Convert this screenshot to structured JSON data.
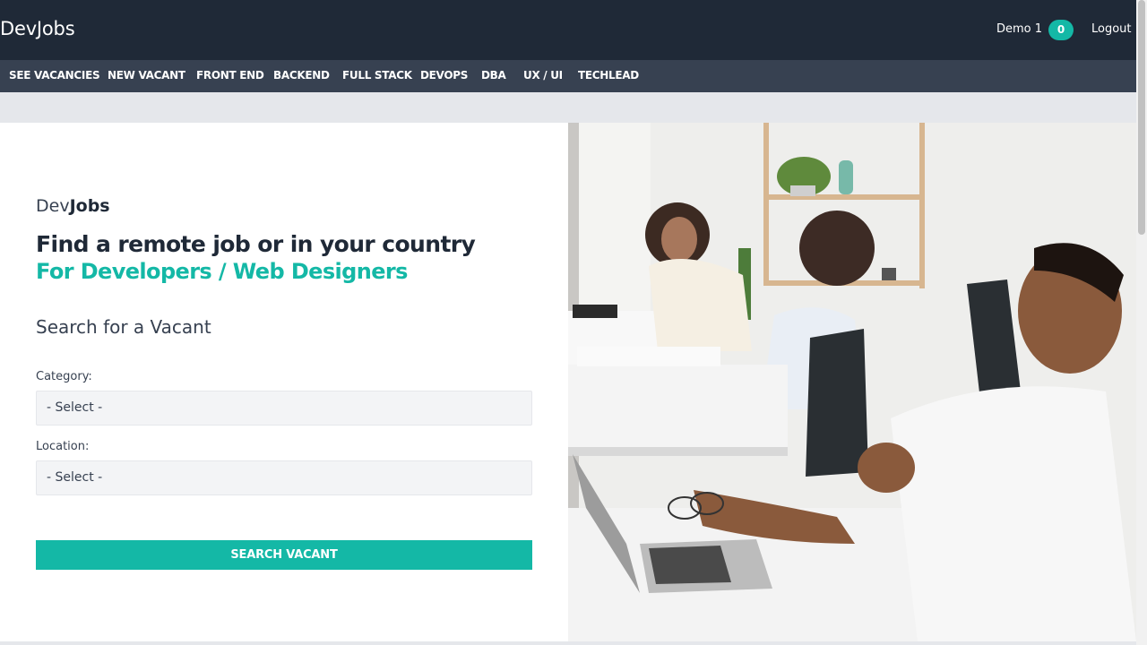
{
  "header": {
    "brand": "DevJobs",
    "user_name": "Demo 1",
    "notification_count": "0",
    "logout_label": "Logout"
  },
  "nav": {
    "items": [
      {
        "label": "SEE VACANCIES"
      },
      {
        "label": "NEW VACANT"
      },
      {
        "label": "FRONT END"
      },
      {
        "label": "BACKEND"
      },
      {
        "label": "FULL STACK"
      },
      {
        "label": "DEVOPS"
      },
      {
        "label": "DBA"
      },
      {
        "label": "UX / UI"
      },
      {
        "label": "TECHLEAD"
      }
    ]
  },
  "hero": {
    "brand_prefix": "Dev",
    "brand_suffix": "Jobs",
    "headline": "Find a remote job or in your country",
    "subheadline": "For Developers / Web Designers",
    "search_title": "Search for a Vacant",
    "category_label": "Category:",
    "category_value": "- Select -",
    "location_label": "Location:",
    "location_value": "- Select -",
    "search_button": "SEARCH VACANT"
  },
  "colors": {
    "topbar": "#1f2937",
    "navbar": "#374151",
    "accent": "#14b8a6"
  }
}
